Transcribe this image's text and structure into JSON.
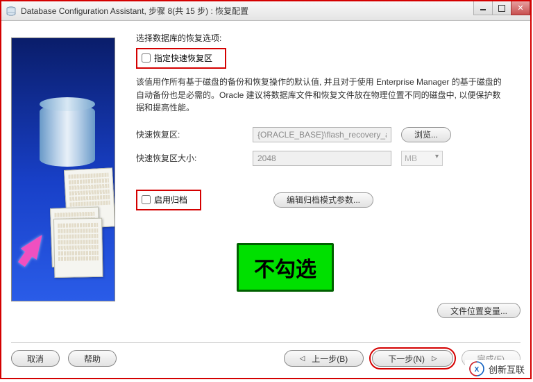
{
  "window": {
    "title": "Database Configuration Assistant, 步骤 8(共 15 步) : 恢复配置"
  },
  "section": {
    "heading": "选择数据库的恢复选项:"
  },
  "fast_recovery": {
    "checkbox_label": "指定快速恢复区",
    "description": "该值用作所有基于磁盘的备份和恢复操作的默认值, 并且对于使用 Enterprise Manager 的基于磁盘的自动备份也是必需的。Oracle 建议将数据库文件和恢复文件放在物理位置不同的磁盘中, 以便保护数据和提高性能。",
    "area_label": "快速恢复区:",
    "area_value": "{ORACLE_BASE}\\flash_recovery_area",
    "browse_label": "浏览...",
    "size_label": "快速恢复区大小:",
    "size_value": "2048",
    "size_unit": "MB"
  },
  "archive": {
    "checkbox_label": "启用归档",
    "edit_button": "编辑归档模式参数..."
  },
  "callout": {
    "text": "不勾选"
  },
  "buttons": {
    "file_location": "文件位置变量...",
    "cancel": "取消",
    "help": "帮助",
    "back": "上一步(B)",
    "next": "下一步(N)",
    "finish": "完成(F)"
  },
  "watermark": {
    "text": "创新互联"
  }
}
